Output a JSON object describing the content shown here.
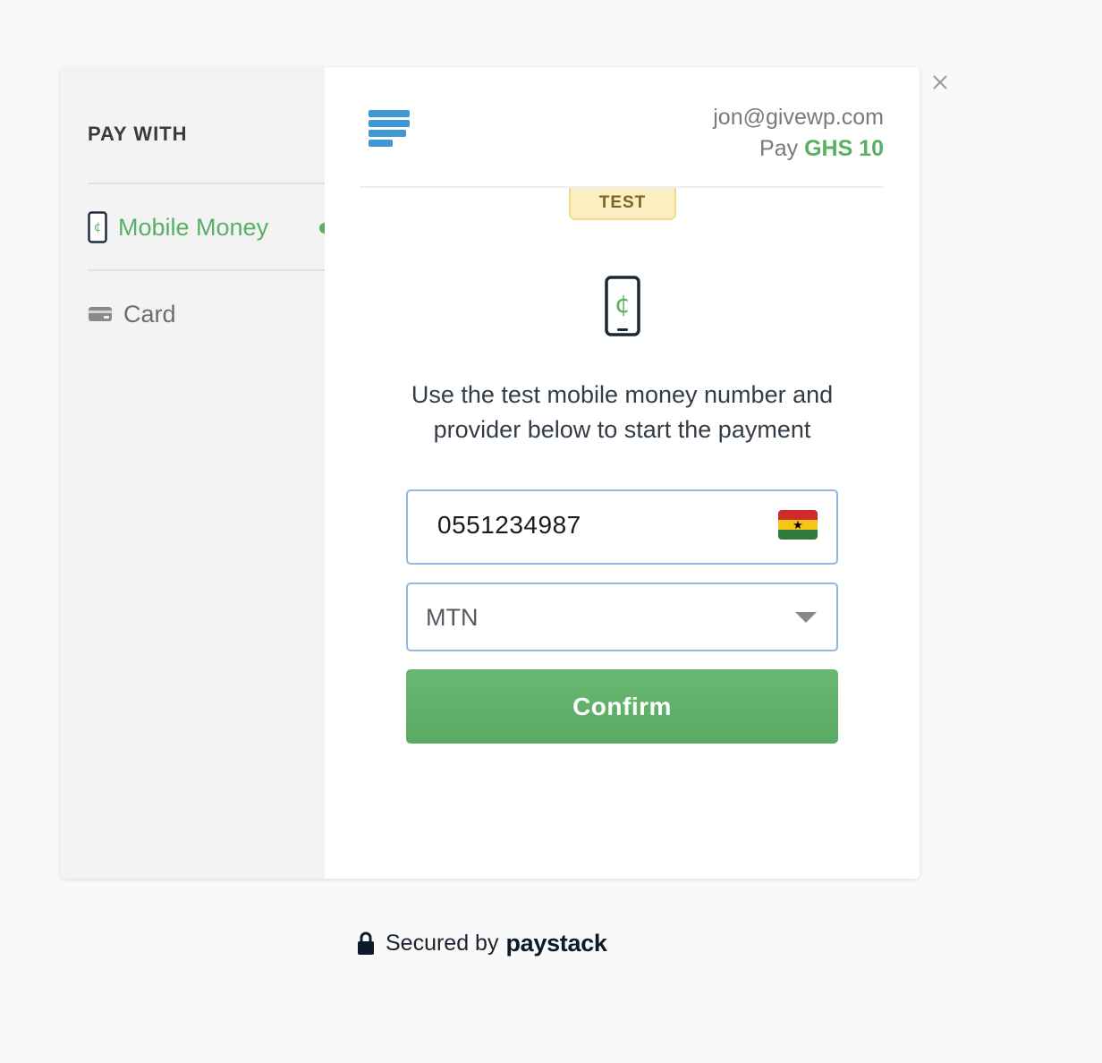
{
  "sidebar": {
    "heading": "PAY WITH",
    "items": [
      {
        "label": "Mobile Money",
        "icon": "mobile-money-icon",
        "active": true
      },
      {
        "label": "Card",
        "icon": "card-icon",
        "active": false
      }
    ]
  },
  "header": {
    "email": "jon@givewp.com",
    "pay_prefix": "Pay",
    "pay_amount": "GHS 10"
  },
  "badge": {
    "label": "TEST"
  },
  "main": {
    "instructions_line1": "Use the test mobile money number and",
    "instructions_line2": "provider below to start the payment",
    "phone_number": "0551234987",
    "provider": "MTN",
    "confirm_label": "Confirm"
  },
  "footer": {
    "secured_text": "Secured by",
    "brand": "paystack"
  },
  "colors": {
    "accent": "#58b064",
    "logo_blue": "#3f97d3",
    "input_border": "#90b8e4",
    "badge_bg": "#fbeec1"
  }
}
